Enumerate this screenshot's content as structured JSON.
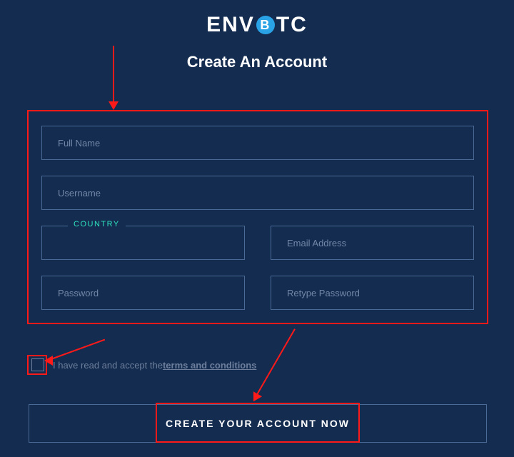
{
  "brand": {
    "pre": "ENV",
    "coin": "B",
    "post": "TC"
  },
  "heading": "Create An Account",
  "fields": {
    "fullname_ph": "Full Name",
    "username_ph": "Username",
    "country_label": "COUNTRY",
    "email_ph": "Email Address",
    "password_ph": "Password",
    "retype_ph": "Retype Password"
  },
  "terms": {
    "lead": "I have read and accept the ",
    "link": "terms and conditions"
  },
  "submit_label": "CREATE YOUR ACCOUNT NOW"
}
